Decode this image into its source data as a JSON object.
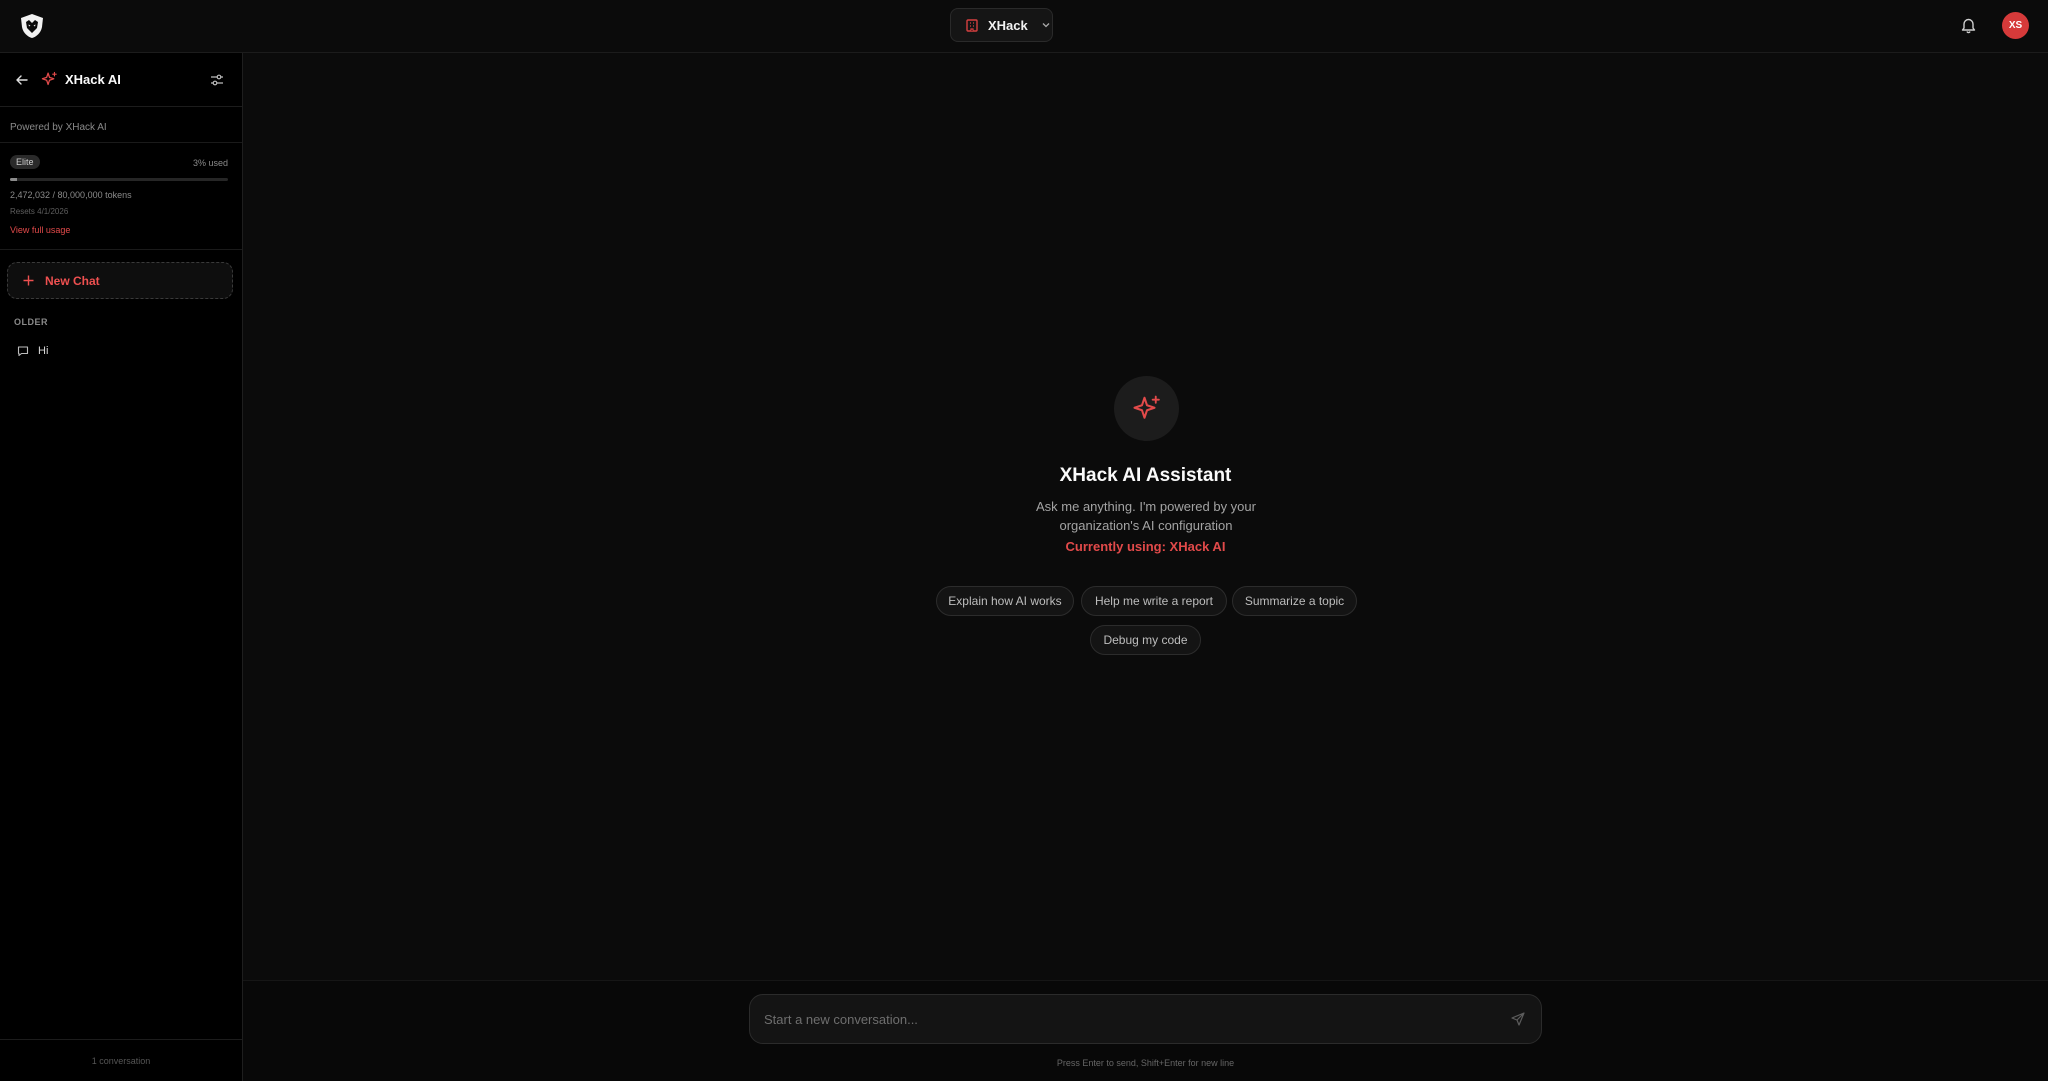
{
  "header": {
    "workspace_name": "XHack",
    "avatar_initials": "XS"
  },
  "sidebar": {
    "title": "XHack AI",
    "powered_by": "Powered by XHack AI",
    "usage": {
      "tier": "Elite",
      "used_text": "3% used",
      "used_fraction": 0.03,
      "tokens_text": "2,472,032 / 80,000,000 tokens",
      "resets_text": "Resets 4/1/2026",
      "view_link": "View full usage"
    },
    "new_chat_label": "New Chat",
    "section_label": "OLDER",
    "conversations": [
      {
        "title": "Hi"
      }
    ],
    "footer": "1 conversation"
  },
  "main": {
    "title": "XHack AI Assistant",
    "subtitle": "Ask me anything. I'm powered by your organization's AI configuration",
    "using": "Currently using: XHack AI",
    "suggestions": [
      "Explain how AI works",
      "Help me write a report",
      "Summarize a topic",
      "Debug my code"
    ]
  },
  "composer": {
    "placeholder": "Start a new conversation...",
    "hint": "Press Enter to send, Shift+Enter for new line"
  },
  "colors": {
    "accent": "#e24a4a",
    "background": "#0b0b0b",
    "sidebar_bg": "#000000"
  }
}
